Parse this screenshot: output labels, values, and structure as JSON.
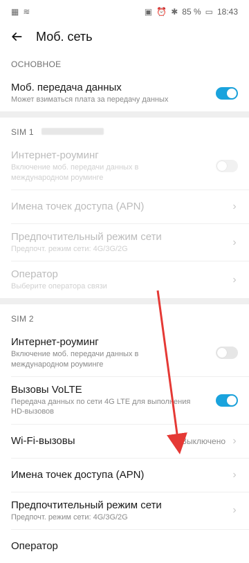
{
  "status": {
    "battery": "85 %",
    "time": "18:43",
    "icons": [
      "sim-blocked-icon",
      "wifi-icon",
      "vibrate-icon",
      "alarm-icon",
      "bluetooth-icon",
      "battery-icon"
    ]
  },
  "appbar": {
    "title": "Моб. сеть"
  },
  "sections": {
    "main": {
      "title": "ОСНОВНОЕ"
    },
    "sim1": {
      "title": "SIM 1"
    },
    "sim2": {
      "title": "SIM 2"
    }
  },
  "main": {
    "mobile_data": {
      "label": "Моб. передача данных",
      "sub": "Может взиматься плата за передачу данных",
      "toggle_state": "on"
    }
  },
  "sim1": {
    "roaming": {
      "label": "Интернет-роуминг",
      "sub": "Включение моб. передачи данных в международном роуминге",
      "toggle_state": "off"
    },
    "apn": {
      "label": "Имена точек доступа (APN)"
    },
    "preferred_mode": {
      "label": "Предпочтительный режим сети",
      "sub": "Предпочт. режим сети: 4G/3G/2G"
    },
    "operator": {
      "label": "Оператор",
      "sub": "Выберите оператора связи"
    }
  },
  "sim2": {
    "roaming": {
      "label": "Интернет-роуминг",
      "sub": "Включение моб. передачи данных в международном роуминге",
      "toggle_state": "off"
    },
    "volte": {
      "label": "Вызовы VoLTE",
      "sub": "Передача данных по сети 4G LTE для выполнения HD-вызовов",
      "toggle_state": "on"
    },
    "wifi_calls": {
      "label": "Wi-Fi-вызовы",
      "value": "Выключено"
    },
    "apn": {
      "label": "Имена точек доступа (APN)"
    },
    "preferred_mode": {
      "label": "Предпочтительный режим сети",
      "sub": "Предпочт. режим сети: 4G/3G/2G"
    },
    "operator": {
      "label": "Оператор"
    }
  },
  "colors": {
    "accent": "#1aa3dd",
    "annotation_arrow": "#e53935"
  }
}
